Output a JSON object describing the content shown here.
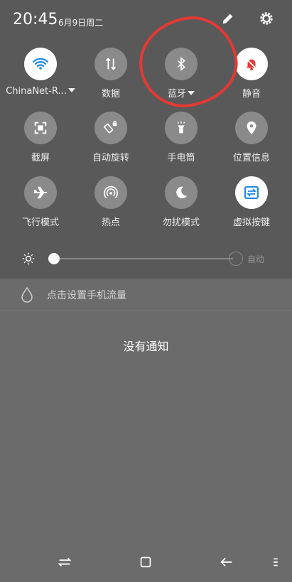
{
  "status": {
    "time": "20:45",
    "date": "6月9日周二"
  },
  "tiles": [
    {
      "label": "ChinaNet-R...",
      "icon": "wifi-icon",
      "active": true,
      "dropdown": true
    },
    {
      "label": "数据",
      "icon": "data-arrows-icon",
      "active": false,
      "dropdown": false
    },
    {
      "label": "蓝牙",
      "icon": "bluetooth-icon",
      "active": false,
      "dropdown": true
    },
    {
      "label": "静音",
      "icon": "bell-muted-icon",
      "active": true,
      "dropdown": false
    },
    {
      "label": "截屏",
      "icon": "screenshot-icon",
      "active": false,
      "dropdown": false
    },
    {
      "label": "自动旋转",
      "icon": "rotate-lock-icon",
      "active": false,
      "dropdown": false
    },
    {
      "label": "手电筒",
      "icon": "flashlight-icon",
      "active": false,
      "dropdown": false
    },
    {
      "label": "位置信息",
      "icon": "location-pin-icon",
      "active": false,
      "dropdown": false
    },
    {
      "label": "飞行模式",
      "icon": "airplane-icon",
      "active": false,
      "dropdown": false
    },
    {
      "label": "热点",
      "icon": "hotspot-icon",
      "active": false,
      "dropdown": false
    },
    {
      "label": "勿扰模式",
      "icon": "moon-icon",
      "active": false,
      "dropdown": false
    },
    {
      "label": "虚拟按键",
      "icon": "virtual-keys-icon",
      "active": true,
      "dropdown": false
    }
  ],
  "brightness": {
    "level": 0.0,
    "auto_label": "自动"
  },
  "data_usage": {
    "label": "点击设置手机流量"
  },
  "notifications": {
    "empty_text": "没有通知"
  },
  "colors": {
    "wifi_accent": "#1e88e5",
    "mute_accent": "#e53935",
    "keys_accent": "#1e88e5",
    "annotation": "#e53935"
  }
}
